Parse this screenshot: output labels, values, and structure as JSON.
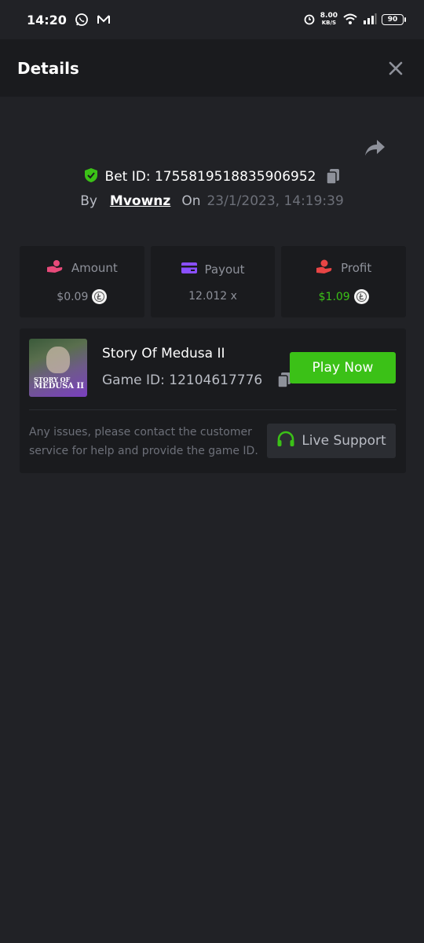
{
  "status_bar": {
    "time": "14:20",
    "net_speed": "8.00",
    "net_unit": "KB/S",
    "battery": "90"
  },
  "header": {
    "title": "Details"
  },
  "bet": {
    "id_label": "Bet ID: 1755819518835906952",
    "by_label": "By",
    "user": "Mvownz",
    "on_label": "On",
    "datetime": "23/1/2023, 14:19:39"
  },
  "stats": [
    {
      "label": "Amount",
      "value": "$0.09",
      "icon": "coins-hand-icon",
      "color": "#e84a7a"
    },
    {
      "label": "Payout",
      "value": "12.012 x",
      "icon": "wallet-card-icon",
      "color": "#8a4fff"
    },
    {
      "label": "Profit",
      "value": "$1.09",
      "icon": "profit-hand-icon",
      "color": "#e84545"
    }
  ],
  "game": {
    "thumb_line1": "STORY OF",
    "thumb_line2": "MEDUSA II",
    "title": "Story Of Medusa II",
    "id_label": "Game ID: 12104617776",
    "play_label": "Play Now",
    "notice": "Any issues, please contact the customer service for help and provide the game ID.",
    "support_label": "Live Support"
  },
  "colors": {
    "accent_green": "#3bc117",
    "background": "#212226",
    "card": "#1a1b1e"
  }
}
